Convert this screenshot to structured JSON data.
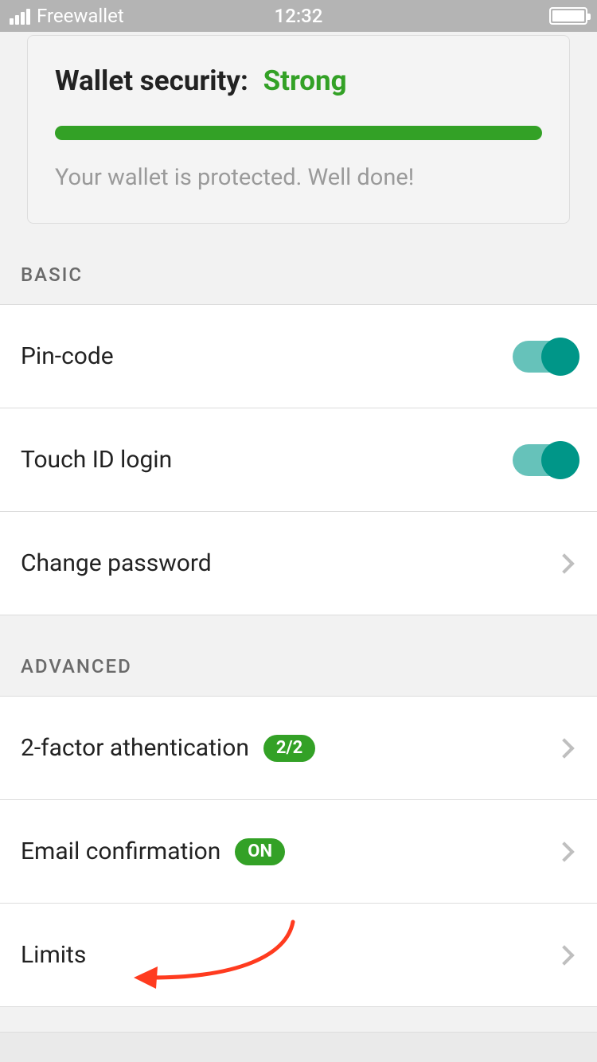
{
  "status_bar": {
    "carrier": "Freewallet",
    "time": "12:32"
  },
  "security_card": {
    "title": "Wallet security:",
    "status": "Strong",
    "subtitle": "Your wallet is protected. Well done!",
    "progress_color": "#33a126"
  },
  "sections": {
    "basic": {
      "header": "BASIC",
      "rows": {
        "pin_code": {
          "label": "Pin-code",
          "toggle_on": true
        },
        "touch_id": {
          "label": "Touch ID login",
          "toggle_on": true
        },
        "change_password": {
          "label": "Change password"
        }
      }
    },
    "advanced": {
      "header": "ADVANCED",
      "rows": {
        "two_factor": {
          "label": "2-factor athentication",
          "badge": "2/2"
        },
        "email_confirmation": {
          "label": "Email confirmation",
          "badge": "ON"
        },
        "limits": {
          "label": "Limits"
        }
      }
    }
  }
}
